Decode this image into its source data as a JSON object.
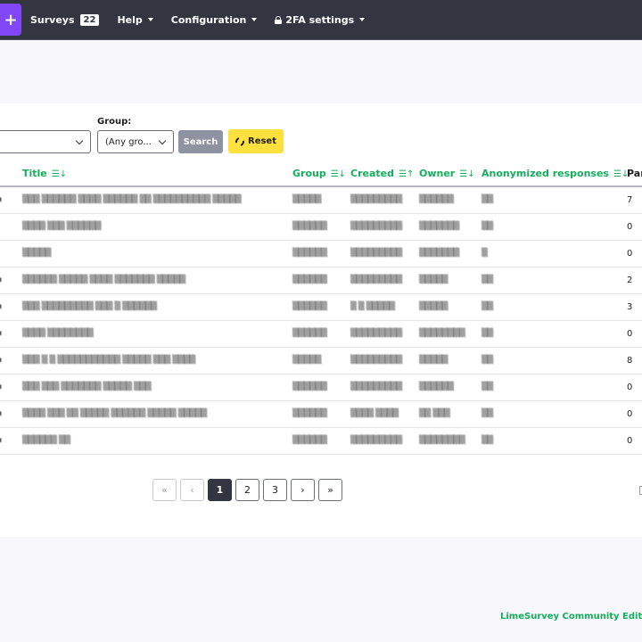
{
  "navbar": {
    "create_button": "+",
    "surveys_label": "Surveys",
    "surveys_count": "22",
    "help_label": "Help",
    "configuration_label": "Configuration",
    "twofa_label": "2FA settings"
  },
  "filters": {
    "status_select_value": "",
    "group_label": "Group:",
    "group_select_value": "(Any gro...",
    "search_button": "Search",
    "reset_button": "Reset"
  },
  "table": {
    "columns": {
      "title": "Title",
      "group": "Group",
      "created": "Created",
      "owner": "Owner",
      "anonymized": "Anonymized responses",
      "partial": "Par"
    },
    "sort_desc_glyph": "☰↓",
    "sort_asc_glyph": "☰↑",
    "rows": [
      {
        "edge": "▪",
        "title": "▒▒▒ ▒▒▒▒▒▒ ▒▒▒▒ ▒▒▒▒▒▒ ▒▒ ▒▒▒▒▒▒▒▒▒▒ ▒▒▒▒▒",
        "group": "▒▒▒▒▒",
        "created": "▒▒▒▒▒▒▒▒▒",
        "owner": "▒▒▒▒▒▒",
        "anon": "▒▒",
        "partial": "7"
      },
      {
        "edge": "",
        "title": "▒▒▒▒ ▒▒▒ ▒▒▒▒▒▒",
        "group": "▒▒▒▒▒▒",
        "created": "▒▒▒▒▒▒▒▒▒",
        "owner": "▒▒▒▒▒▒▒",
        "anon": "▒▒",
        "partial": "0"
      },
      {
        "edge": "",
        "title": "▒▒▒▒▒",
        "group": "▒▒▒▒▒▒",
        "created": "▒▒▒▒▒▒▒▒▒",
        "owner": "▒▒▒▒▒▒▒",
        "anon": "▒",
        "partial": "0"
      },
      {
        "edge": "▪",
        "title": "▒▒▒▒▒▒ ▒▒▒▒▒ ▒▒▒▒ ▒▒▒▒▒▒▒ ▒▒▒▒▒",
        "group": "▒▒▒▒▒▒",
        "created": "▒▒▒▒▒▒▒▒▒",
        "owner": "▒▒▒▒▒",
        "anon": "▒▒",
        "partial": "2"
      },
      {
        "edge": "▪",
        "title": "▒▒▒ ▒▒▒▒▒▒▒▒▒ ▒▒▒ ▒ ▒▒▒▒▒▒",
        "group": "▒▒▒▒▒▒",
        "created": "▒ ▒ ▒▒▒▒▒",
        "owner": "▒▒▒▒▒",
        "anon": "▒▒",
        "partial": "3"
      },
      {
        "edge": "▪",
        "title": "▒▒▒▒ ▒▒▒▒▒▒▒▒",
        "group": "▒▒▒▒▒▒",
        "created": "▒▒▒▒▒▒▒▒▒",
        "owner": "▒▒▒▒▒▒▒▒",
        "anon": "▒▒",
        "partial": "0"
      },
      {
        "edge": "▪",
        "title": "▒▒▒ ▒ ▒ ▒▒▒▒▒▒▒▒▒▒▒ ▒▒▒▒▒ ▒▒▒ ▒▒▒▒",
        "group": "▒▒▒▒▒",
        "created": "▒▒▒▒▒▒▒▒▒",
        "owner": "▒▒▒▒▒",
        "anon": "▒▒",
        "partial": "8"
      },
      {
        "edge": "▪",
        "title": "▒▒▒ ▒▒▒ ▒▒▒▒▒▒▒ ▒▒▒▒▒ ▒▒▒",
        "group": "▒▒▒▒▒▒",
        "created": "▒▒▒▒▒▒▒▒▒",
        "owner": "▒▒▒▒▒▒",
        "anon": "▒▒",
        "partial": "0"
      },
      {
        "edge": "▪",
        "title": "▒▒▒▒ ▒▒▒ ▒▒ ▒▒▒▒▒ ▒▒▒▒▒▒ ▒▒▒▒▒ ▒▒▒▒▒",
        "group": "▒▒▒▒▒▒",
        "created": "▒▒▒▒ ▒▒▒▒",
        "owner": "▒▒ ▒▒▒",
        "anon": "▒▒",
        "partial": "0"
      },
      {
        "edge": "▪",
        "title": "▒▒▒▒▒▒ ▒▒",
        "group": "▒▒▒▒▒▒",
        "created": "▒▒▒▒▒▒▒▒▒",
        "owner": "▒▒▒▒▒▒▒▒",
        "anon": "▒▒",
        "partial": "0"
      }
    ]
  },
  "pagination": {
    "first": "«",
    "prev": "‹",
    "pages": [
      "1",
      "2",
      "3"
    ],
    "current": "1",
    "next": "›",
    "last": "»"
  },
  "footer": {
    "brand": "LimeSurvey Community Edition"
  },
  "colors": {
    "navbar_bg": "#333641",
    "accent_purple": "#8146f6",
    "accent_green": "#14ae5c",
    "reset_yellow": "#fee13f",
    "search_grey": "#8f92a1"
  }
}
